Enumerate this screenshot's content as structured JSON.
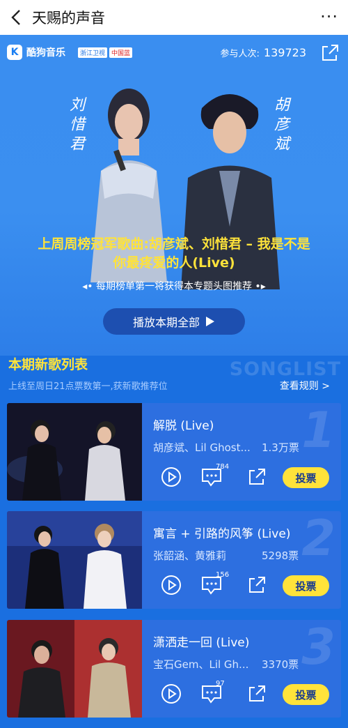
{
  "header": {
    "title": "天赐的声音",
    "more_label": "···"
  },
  "hero": {
    "brand": "酷狗音乐",
    "brand_k": "K",
    "partner_a": "浙江卫视",
    "partner_b": "中国蓝",
    "participants_label": "参与人次:",
    "participants_count": "139723",
    "name_left": "刘惜君",
    "name_right": "胡彦斌",
    "caption_line1": "上周周榜冠军歌曲:胡彦斌、刘惜君 – 我是不是",
    "caption_line2": "你最疼爱的人(Live)",
    "sub": "◂• 每期榜单第一将获得本专题头图推荐 •▸",
    "play_all": "播放本期全部"
  },
  "songlist": {
    "title": "本期新歌列表",
    "watermark": "SONGLIST",
    "subtitle": "上线至周日21点票数第一,获新歌推荐位",
    "rules": "查看规则 >",
    "items": [
      {
        "rank": "1",
        "title": "解脱 (Live)",
        "artist": "胡彦斌、Lil Ghost...",
        "votes": "1.3万票",
        "comments": "784",
        "vote_label": "投票"
      },
      {
        "rank": "2",
        "title": "寓言 + 引路的风筝 (Live)",
        "artist": "张韶涵、黄雅莉",
        "votes": "5298票",
        "comments": "156",
        "vote_label": "投票"
      },
      {
        "rank": "3",
        "title": "潇洒走一回 (Live)",
        "artist": "宝石Gem、Lil Gh...",
        "votes": "3370票",
        "comments": "97",
        "vote_label": "投票"
      }
    ]
  },
  "colors": {
    "accent_yellow": "#ffe33a",
    "bg_blue": "#1a6fe0",
    "card_blue": "#2d6fe0"
  }
}
